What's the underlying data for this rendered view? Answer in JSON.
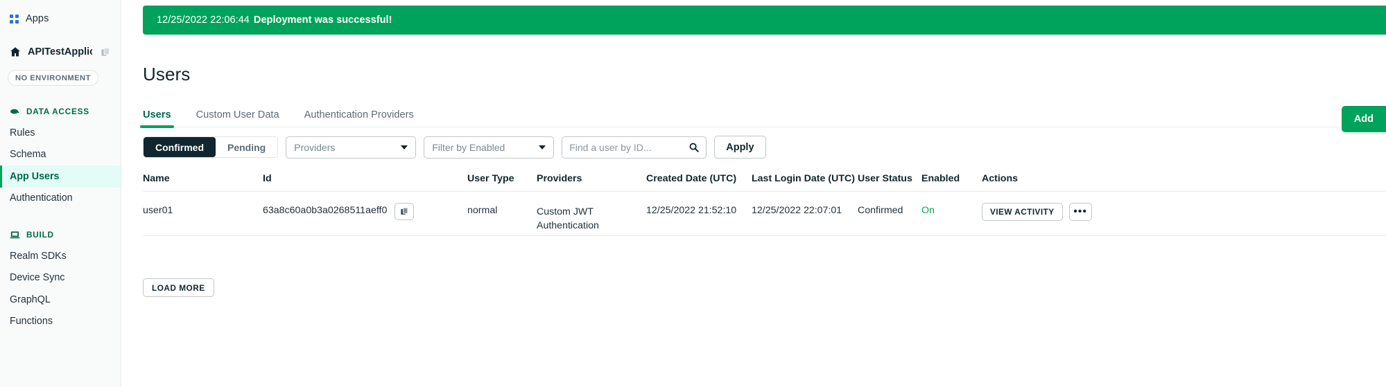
{
  "sidebar": {
    "apps_label": "Apps",
    "app_name": "APITestApplic...",
    "environment_badge": "NO ENVIRONMENT",
    "sections": [
      {
        "title": "DATA ACCESS",
        "icon": "cloud-icon",
        "items": [
          {
            "label": "Rules",
            "active": false
          },
          {
            "label": "Schema",
            "active": false
          },
          {
            "label": "App Users",
            "active": true
          },
          {
            "label": "Authentication",
            "active": false
          }
        ]
      },
      {
        "title": "BUILD",
        "icon": "laptop-icon",
        "items": [
          {
            "label": "Realm SDKs",
            "active": false
          },
          {
            "label": "Device Sync",
            "active": false
          },
          {
            "label": "GraphQL",
            "active": false
          },
          {
            "label": "Functions",
            "active": false
          }
        ]
      }
    ]
  },
  "banner": {
    "timestamp": "12/25/2022 22:06:44",
    "message": "Deployment was successful!",
    "color": "#00A35C"
  },
  "page": {
    "title": "Users"
  },
  "tabs": [
    {
      "label": "Users",
      "active": true
    },
    {
      "label": "Custom User Data",
      "active": false
    },
    {
      "label": "Authentication Providers",
      "active": false
    }
  ],
  "toolbar": {
    "segmented": [
      {
        "label": "Confirmed",
        "selected": true
      },
      {
        "label": "Pending",
        "selected": false
      }
    ],
    "providers_select": "Providers",
    "enabled_select": "Filter by Enabled",
    "search_placeholder": "Find a user by ID...",
    "search_value": "",
    "apply_label": "Apply",
    "add_user_label": "Add"
  },
  "table": {
    "columns": [
      "Name",
      "Id",
      "User Type",
      "Providers",
      "Created Date (UTC)",
      "Last Login Date (UTC)",
      "User Status",
      "Enabled",
      "Actions"
    ],
    "rows": [
      {
        "name": "user01",
        "id": "63a8c60a0b3a0268511aeff0",
        "user_type": "normal",
        "providers": "Custom JWT Authentication",
        "created_date": "12/25/2022 21:52:10",
        "last_login_date": "12/25/2022 22:07:01",
        "user_status": "Confirmed",
        "enabled": "On",
        "view_activity_label": "VIEW ACTIVITY",
        "more_label": "•••"
      }
    ],
    "load_more_label": "LOAD MORE"
  }
}
